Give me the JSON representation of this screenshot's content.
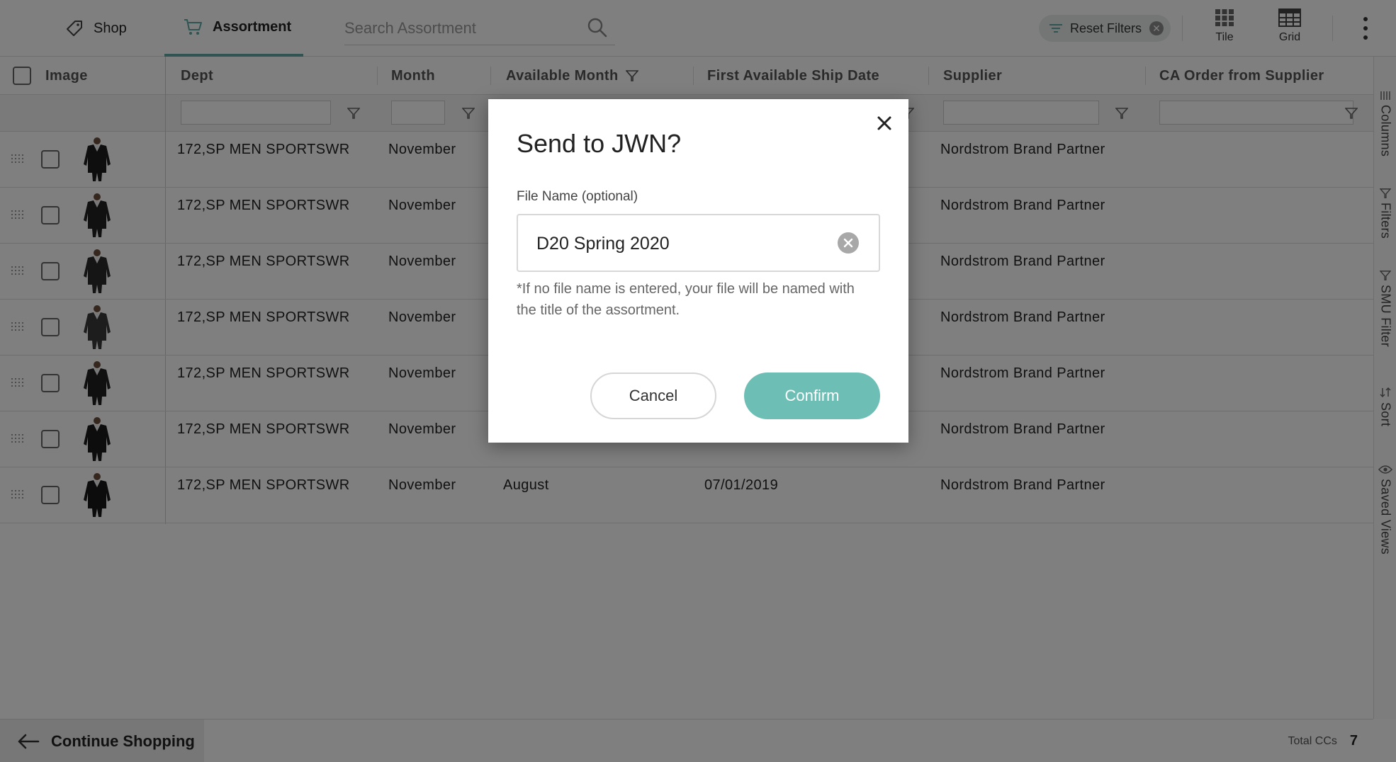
{
  "topbar": {
    "shop_label": "Shop",
    "assortment_label": "Assortment",
    "search_placeholder": "Search Assortment",
    "reset_filters_label": "Reset Filters",
    "tile_label": "Tile",
    "grid_label": "Grid"
  },
  "colors": {
    "accent": "#6dbfb6",
    "tab_underline": "#5fa8a2"
  },
  "columns": [
    "Image",
    "Dept",
    "Month",
    "Available Month",
    "First Available Ship Date",
    "Supplier",
    "CA Order from Supplier"
  ],
  "rows": [
    {
      "dept": "172,SP MEN SPORTSWR",
      "month": "November",
      "available_month": "",
      "ship_date": "",
      "supplier": "Nordstrom Brand Partner"
    },
    {
      "dept": "172,SP MEN SPORTSWR",
      "month": "November",
      "available_month": "",
      "ship_date": "",
      "supplier": "Nordstrom Brand Partner"
    },
    {
      "dept": "172,SP MEN SPORTSWR",
      "month": "November",
      "available_month": "",
      "ship_date": "",
      "supplier": "Nordstrom Brand Partner"
    },
    {
      "dept": "172,SP MEN SPORTSWR",
      "month": "November",
      "available_month": "",
      "ship_date": "",
      "supplier": "Nordstrom Brand Partner"
    },
    {
      "dept": "172,SP MEN SPORTSWR",
      "month": "November",
      "available_month": "",
      "ship_date": "",
      "supplier": "Nordstrom Brand Partner"
    },
    {
      "dept": "172,SP MEN SPORTSWR",
      "month": "November",
      "available_month": "",
      "ship_date": "",
      "supplier": "Nordstrom Brand Partner"
    },
    {
      "dept": "172,SP MEN SPORTSWR",
      "month": "November",
      "available_month": "August",
      "ship_date": "07/01/2019",
      "supplier": "Nordstrom Brand Partner"
    }
  ],
  "side_rail": [
    "Columns",
    "Filters",
    "SMU Filter",
    "Sort",
    "Saved Views"
  ],
  "footer": {
    "continue_label": "Continue Shopping",
    "total_label": "Total CCs",
    "total_value": "7"
  },
  "modal": {
    "title": "Send to JWN?",
    "field_label": "File Name (optional)",
    "field_value": "D20 Spring 2020",
    "hint": "*If no file name is entered, your file will be named with the title of the assortment.",
    "cancel_label": "Cancel",
    "confirm_label": "Confirm"
  }
}
